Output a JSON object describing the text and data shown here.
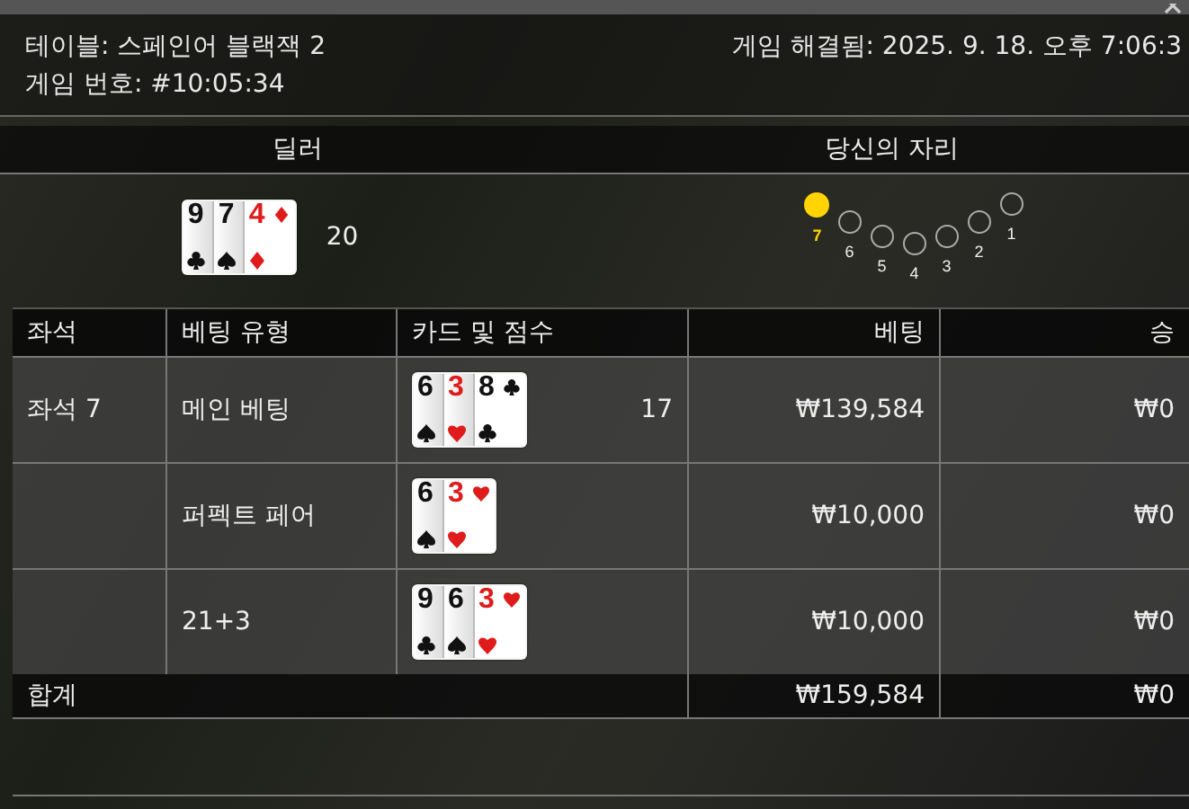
{
  "header": {
    "table": "테이블: 스페인어 블랙잭 2",
    "resolved": "게임 해결됨: 2025. 9. 18. 오후 7:06:3",
    "game_number": "게임 번호: #10:05:34"
  },
  "dealer": {
    "heading": "딜러",
    "cards": [
      {
        "rank": "9",
        "kind": "clubs"
      },
      {
        "rank": "7",
        "kind": "spades"
      },
      {
        "rank": "4",
        "kind": "diamonds"
      }
    ],
    "score": "20"
  },
  "seat_map": {
    "heading": "당신의 자리",
    "seats": [
      {
        "label": "7",
        "selected": true
      },
      {
        "label": "6",
        "selected": false
      },
      {
        "label": "5",
        "selected": false
      },
      {
        "label": "4",
        "selected": false
      },
      {
        "label": "3",
        "selected": false
      },
      {
        "label": "2",
        "selected": false
      },
      {
        "label": "1",
        "selected": false
      }
    ]
  },
  "table": {
    "columns": [
      "좌석",
      "베팅 유형",
      "카드 및 점수",
      "베팅",
      "승"
    ],
    "rows": [
      {
        "seat": "좌석 7",
        "bet_type": "메인 베팅",
        "cards": [
          {
            "rank": "6",
            "kind": "spades"
          },
          {
            "rank": "3",
            "kind": "hearts"
          },
          {
            "rank": "8",
            "kind": "clubs"
          }
        ],
        "score": "17",
        "bet": "₩139,584",
        "win": "₩0"
      },
      {
        "bet_type": "퍼펙트 페어",
        "cards": [
          {
            "rank": "6",
            "kind": "spades"
          },
          {
            "rank": "3",
            "kind": "hearts"
          }
        ],
        "bet": "₩10,000",
        "win": "₩0"
      },
      {
        "bet_type": "21+3",
        "cards": [
          {
            "rank": "9",
            "kind": "clubs"
          },
          {
            "rank": "6",
            "kind": "spades"
          },
          {
            "rank": "3",
            "kind": "hearts"
          }
        ],
        "bet": "₩10,000",
        "win": "₩0"
      }
    ],
    "total": {
      "label": "합계",
      "bet": "₩159,584",
      "win": "₩0"
    }
  }
}
